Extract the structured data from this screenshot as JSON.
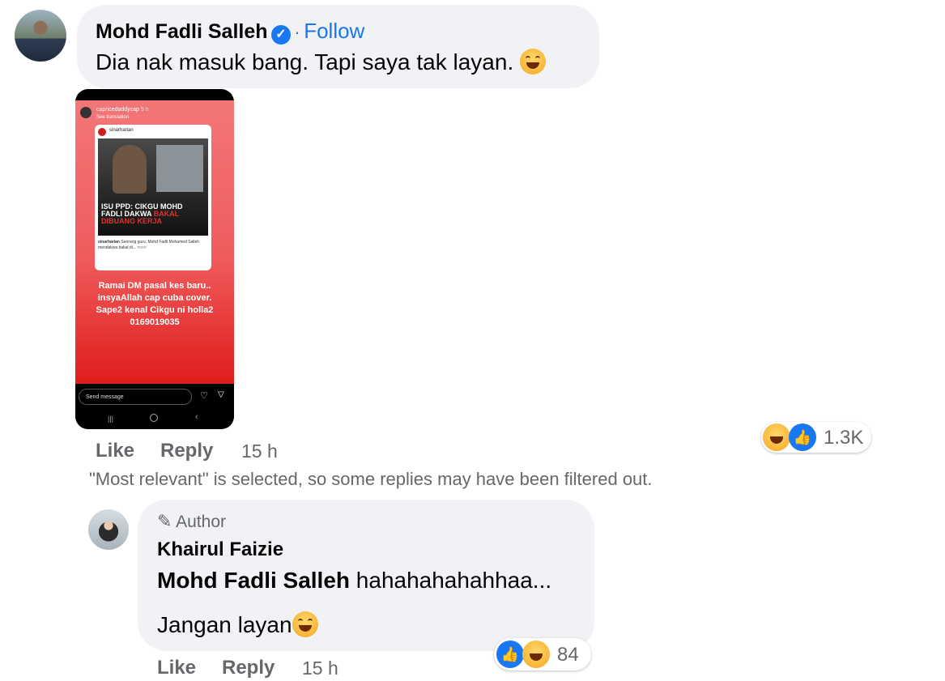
{
  "comment": {
    "author": "Mohd Fadli Salleh",
    "follow_sep": "·",
    "follow": "Follow",
    "text": "Dia nak masuk bang. Tapi saya tak layan.",
    "image": {
      "ig_user": "capricedaddycap",
      "ig_time": "5 h",
      "see_translation": "See translation",
      "post_source": "sinarharian",
      "headline_line1": "ISU PPD: CIKGU MOHD",
      "headline_line2": "FADLI DAKWA",
      "headline_red": "BAKAL",
      "headline_line3": "DIBUANG KERJA",
      "caption_user": "sinarharian",
      "caption_text": "Seorang guru, Mohd Fadli Mohamed Salleh mendakwa bakal di...",
      "caption_more": "more",
      "story_text": "Ramai DM pasal kes baru.. insyaAllah cap cuba cover. Sape2 kenal Cikgu ni holla2 0169019035",
      "send_message": "Send message"
    },
    "actions": {
      "like": "Like",
      "reply": "Reply",
      "time": "15 h"
    },
    "reaction_count": "1.3K"
  },
  "filter_notice": "\"Most relevant\" is selected, so some replies may have been filtered out.",
  "reply": {
    "badge": "Author",
    "author": "Khairul Faizie",
    "mention": "Mohd Fadli Salleh",
    "text1": "hahahahahahhaa...",
    "text2": "Jangan layan",
    "actions": {
      "like": "Like",
      "reply": "Reply",
      "time": "15 h"
    },
    "reaction_count": "84"
  }
}
